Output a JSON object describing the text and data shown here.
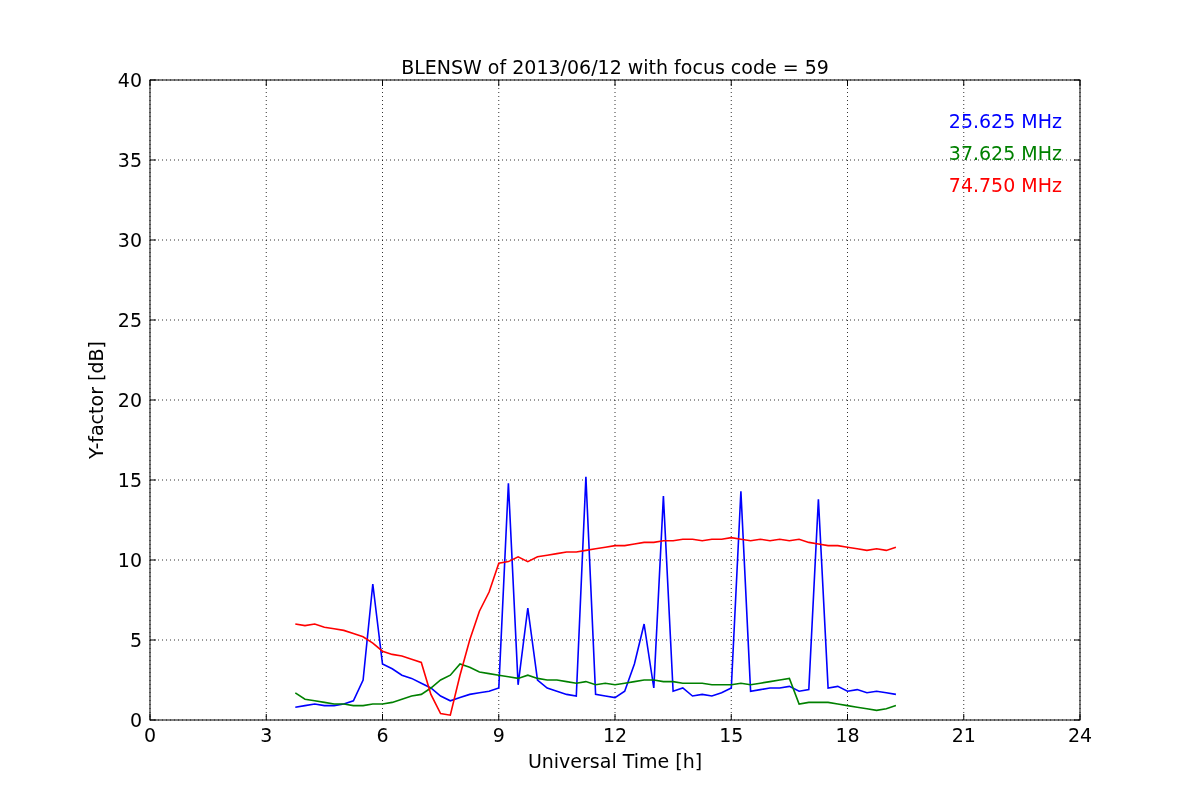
{
  "chart_data": {
    "type": "line",
    "title": "BLENSW of 2013/06/12 with focus code = 59",
    "xlabel": "Universal Time [h]",
    "ylabel": "Y-factor [dB]",
    "x": [
      3.75,
      4,
      4.25,
      4.5,
      4.75,
      5,
      5.25,
      5.5,
      5.75,
      6,
      6.25,
      6.5,
      6.75,
      7,
      7.25,
      7.5,
      7.75,
      8,
      8.25,
      8.5,
      8.75,
      9,
      9.25,
      9.5,
      9.75,
      10,
      10.25,
      10.5,
      10.75,
      11,
      11.25,
      11.5,
      11.75,
      12,
      12.25,
      12.5,
      12.75,
      13,
      13.25,
      13.5,
      13.75,
      14,
      14.25,
      14.5,
      14.75,
      15,
      15.25,
      15.5,
      15.75,
      16,
      16.25,
      16.5,
      16.75,
      17,
      17.25,
      17.5,
      17.75,
      18,
      18.25,
      18.5,
      18.75,
      19,
      19.25
    ],
    "series": [
      {
        "name": "25.625 MHz",
        "color": "#0000ff",
        "values": [
          0.8,
          0.9,
          1.0,
          0.9,
          0.9,
          1.0,
          1.2,
          2.5,
          8.5,
          3.5,
          3.2,
          2.8,
          2.6,
          2.3,
          2.0,
          1.5,
          1.2,
          1.4,
          1.6,
          1.7,
          1.8,
          2.0,
          14.8,
          2.2,
          7.0,
          2.5,
          2.0,
          1.8,
          1.6,
          1.5,
          15.2,
          1.6,
          1.5,
          1.4,
          1.8,
          3.5,
          6.0,
          2.0,
          14.0,
          1.8,
          2.0,
          1.5,
          1.6,
          1.5,
          1.7,
          2.0,
          14.3,
          1.8,
          1.9,
          2.0,
          2.0,
          2.1,
          1.8,
          1.9,
          13.8,
          2.0,
          2.1,
          1.8,
          1.9,
          1.7,
          1.8,
          1.7,
          1.6
        ]
      },
      {
        "name": "37.625 MHz",
        "color": "#008000",
        "values": [
          1.7,
          1.3,
          1.2,
          1.1,
          1.0,
          1.0,
          0.9,
          0.9,
          1.0,
          1.0,
          1.1,
          1.3,
          1.5,
          1.6,
          2.0,
          2.5,
          2.8,
          3.5,
          3.3,
          3.0,
          2.9,
          2.8,
          2.7,
          2.6,
          2.8,
          2.6,
          2.5,
          2.5,
          2.4,
          2.3,
          2.4,
          2.2,
          2.3,
          2.2,
          2.3,
          2.4,
          2.5,
          2.5,
          2.4,
          2.4,
          2.3,
          2.3,
          2.3,
          2.2,
          2.2,
          2.2,
          2.3,
          2.2,
          2.3,
          2.4,
          2.5,
          2.6,
          1.0,
          1.1,
          1.1,
          1.1,
          1.0,
          0.9,
          0.8,
          0.7,
          0.6,
          0.7,
          0.9
        ]
      },
      {
        "name": "74.750 MHz",
        "color": "#ff0000",
        "values": [
          6.0,
          5.9,
          6.0,
          5.8,
          5.7,
          5.6,
          5.4,
          5.2,
          4.8,
          4.3,
          4.1,
          4.0,
          3.8,
          3.6,
          1.6,
          0.4,
          0.3,
          2.8,
          5.0,
          6.8,
          8.0,
          9.8,
          9.9,
          10.2,
          9.9,
          10.2,
          10.3,
          10.4,
          10.5,
          10.5,
          10.6,
          10.7,
          10.8,
          10.9,
          10.9,
          11.0,
          11.1,
          11.1,
          11.2,
          11.2,
          11.3,
          11.3,
          11.2,
          11.3,
          11.3,
          11.4,
          11.3,
          11.2,
          11.3,
          11.2,
          11.3,
          11.2,
          11.3,
          11.1,
          11.0,
          10.9,
          10.9,
          10.8,
          10.7,
          10.6,
          10.7,
          10.6,
          10.8
        ]
      }
    ],
    "grid": true,
    "xlim": [
      0,
      24
    ],
    "ylim": [
      0,
      40
    ],
    "xticks": [
      0,
      3,
      6,
      9,
      12,
      15,
      18,
      21,
      24
    ],
    "yticks": [
      0,
      5,
      10,
      15,
      20,
      25,
      30,
      35,
      40
    ]
  }
}
